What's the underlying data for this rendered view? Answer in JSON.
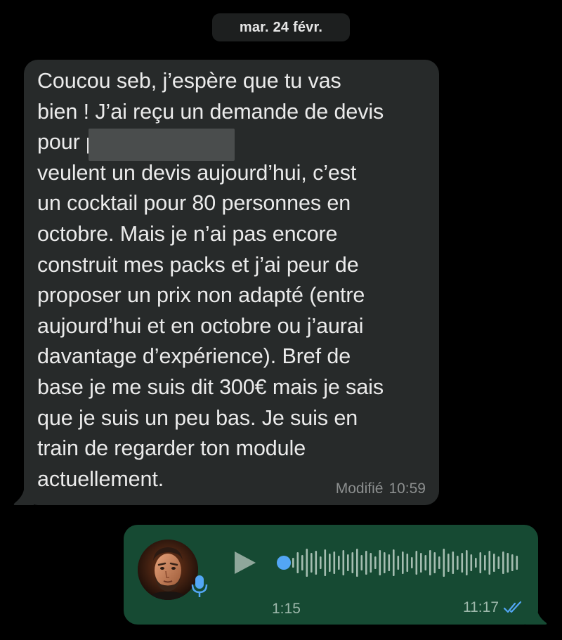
{
  "date_separator": "mar. 24 févr.",
  "incoming_message": {
    "text": "Coucou seb, j’espère que tu vas\nbien ! J’ai reçu un demande de devis\npour                                par réseau). Ils\nveulent un devis aujourd’hui, c’est\nun cocktail pour 80 personnes en\noctobre. Mais je n’ai pas encore\nconstruit mes packs et j’ai peur de\nproposer un prix non adapté (entre\naujourd’hui et en octobre ou j’aurai\ndavantage d’expérience). Bref de\nbase je me suis dit 300€ mais je sais\nque je suis un peu bas. Je suis en\ntrain de regarder ton module\nactuellement.",
    "edited_label": "Modifié",
    "time": "10:59"
  },
  "voice_message": {
    "duration": "1:15",
    "time": "11:17",
    "playback_progress": 0.0,
    "read_status_icon": "double-check-read-icon",
    "play_icon": "play-icon",
    "mic_icon": "microphone-icon"
  },
  "colors": {
    "background": "#000000",
    "incoming_bubble": "#272a2a",
    "outgoing_bubble": "#164a33",
    "accent_blue": "#53a6f5",
    "meta_gray": "#8c8f8f"
  }
}
